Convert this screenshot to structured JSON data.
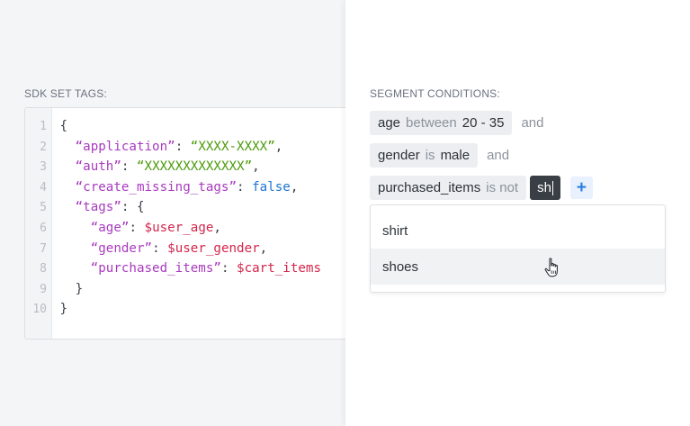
{
  "left": {
    "section_label": "SDK SET TAGS:",
    "code": {
      "line_numbers": [
        "1",
        "2",
        "3",
        "4",
        "5",
        "6",
        "7",
        "8",
        "9",
        "10"
      ],
      "lines": [
        [
          {
            "t": "punct",
            "v": "{"
          }
        ],
        [
          {
            "t": "punct",
            "v": "  "
          },
          {
            "t": "key",
            "v": "“application”"
          },
          {
            "t": "punct",
            "v": ": "
          },
          {
            "t": "str",
            "v": "“XXXX-XXXX”"
          },
          {
            "t": "punct",
            "v": ","
          }
        ],
        [
          {
            "t": "punct",
            "v": "  "
          },
          {
            "t": "key",
            "v": "“auth”"
          },
          {
            "t": "punct",
            "v": ": "
          },
          {
            "t": "str",
            "v": "“XXXXXXXXXXXXX”"
          },
          {
            "t": "punct",
            "v": ","
          }
        ],
        [
          {
            "t": "punct",
            "v": "  "
          },
          {
            "t": "key",
            "v": "“create_missing_tags”"
          },
          {
            "t": "punct",
            "v": ": "
          },
          {
            "t": "bool",
            "v": "false"
          },
          {
            "t": "punct",
            "v": ","
          }
        ],
        [
          {
            "t": "punct",
            "v": "  "
          },
          {
            "t": "key",
            "v": "“tags”"
          },
          {
            "t": "punct",
            "v": ": {"
          }
        ],
        [
          {
            "t": "punct",
            "v": "    "
          },
          {
            "t": "key",
            "v": "“age”"
          },
          {
            "t": "punct",
            "v": ": "
          },
          {
            "t": "var",
            "v": "$user_age"
          },
          {
            "t": "punct",
            "v": ","
          }
        ],
        [
          {
            "t": "punct",
            "v": "    "
          },
          {
            "t": "key",
            "v": "“gender”"
          },
          {
            "t": "punct",
            "v": ": "
          },
          {
            "t": "var",
            "v": "$user_gender"
          },
          {
            "t": "punct",
            "v": ","
          }
        ],
        [
          {
            "t": "punct",
            "v": "    "
          },
          {
            "t": "key",
            "v": "“purchased_items”"
          },
          {
            "t": "punct",
            "v": ": "
          },
          {
            "t": "var",
            "v": "$cart_items"
          }
        ],
        [
          {
            "t": "punct",
            "v": "  }"
          }
        ],
        [
          {
            "t": "punct",
            "v": "}"
          }
        ]
      ]
    }
  },
  "right": {
    "section_label": "SEGMENT CONDITIONS:",
    "conditions": [
      {
        "field": "age",
        "operator": "between",
        "value": "20 - 35",
        "joiner": "and"
      },
      {
        "field": "gender",
        "operator": "is",
        "value": "male",
        "joiner": "and"
      },
      {
        "field": "purchased_items",
        "operator": "is not",
        "input_value": "sh",
        "add_label": "+"
      }
    ],
    "dropdown": {
      "options": [
        "shirt",
        "shoes"
      ],
      "hovered_index": 1
    }
  },
  "colors": {
    "key": "#a83bbf",
    "string": "#4b9a0b",
    "boolean": "#1d74d0",
    "variable": "#d3264b",
    "accent": "#2b7de1"
  },
  "icons": {
    "cursor": "hand-pointer-icon"
  }
}
